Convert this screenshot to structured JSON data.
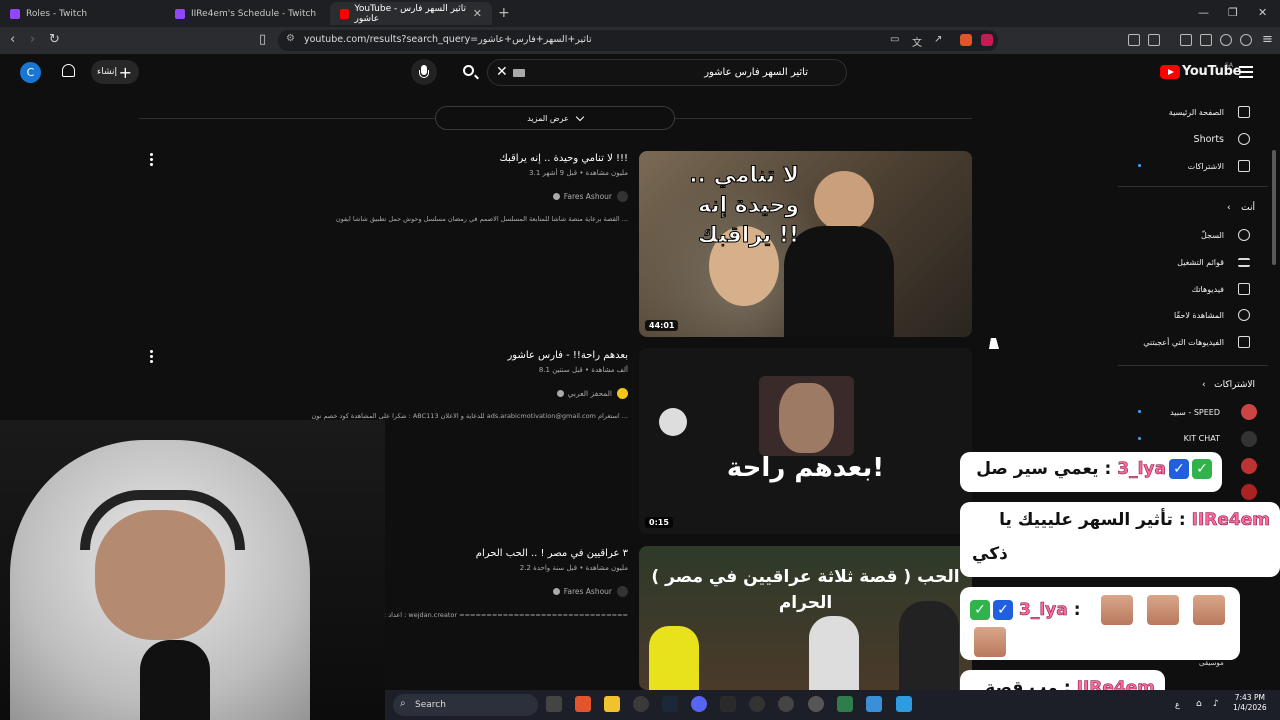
{
  "browser": {
    "tabs": [
      {
        "title": "Roles - Twitch",
        "active": false
      },
      {
        "title": "IIRe4em's Schedule - Twitch",
        "active": false
      },
      {
        "title": "YouTube - تاثير السهر فارس عاشور",
        "active": true
      }
    ],
    "url": "youtube.com/results?search_query=تاثير+السهر+فارس+عاشور",
    "new_tab": "+"
  },
  "youtube": {
    "logo": "YouTube",
    "region": "SA",
    "search_query": "تاثير السهر فارس عاشور",
    "create_label": "إنشاء",
    "avatar_letter": "C",
    "show_more": "عرض المزيد"
  },
  "sidebar": {
    "main": [
      {
        "label": "الصفحة الرئيسية",
        "icon": "home-icon"
      },
      {
        "label": "Shorts",
        "icon": "shorts-icon"
      },
      {
        "label": "الاشتراكات",
        "icon": "subscriptions-icon"
      }
    ],
    "you_header": "أنت",
    "you": [
      {
        "label": "السجلّ",
        "icon": "history-icon"
      },
      {
        "label": "قوائم التشغيل",
        "icon": "playlists-icon"
      },
      {
        "label": "فيديوهاتك",
        "icon": "your-videos-icon"
      },
      {
        "label": "المشاهدة لاحقًا",
        "icon": "watch-later-icon"
      },
      {
        "label": "الفيديوهات التي أعجبتني",
        "icon": "liked-icon"
      }
    ],
    "subs_header": "الاشتراكات",
    "subs": [
      {
        "label": "سبيد - SPEED"
      },
      {
        "label": "KIT CHAT"
      }
    ],
    "partial_label": "موسيقى"
  },
  "videos": [
    {
      "title": "لا تنامي وحيدة .. إنه يراقبك !!!",
      "meta": "3.1 مليون مشاهدة • قبل 9 أشهر",
      "channel": "Fares Ashour",
      "description": "القصة برعاية منصة شاشا للمتابعة المسلسل الاصمم في رمضان مسلسل وحوش حمل تطبيق شاشا ايفون ...",
      "duration": "44:01",
      "thumb_text": "لا تنامي .. وحيدة إنه يراقبك !!"
    },
    {
      "title": "بعدهم راحة!! - فارس عاشور",
      "meta": "8.1 ألف مشاهدة • قبل سنتين",
      "channel": "المحفز العربي",
      "description": "شكرا على المشاهدة كود خصم نون : ABC113 للدعاية و الاعلان ads.arabicmotivation@gmail.com استغرام ...",
      "duration": "0:15",
      "thumb_text": "بعدهم راحة!"
    },
    {
      "title": "٣ عراقيين في مصر ! .. الحب الحرام",
      "meta": "2.2 مليون مشاهدة • قبل سنة واحدة",
      "channel": "Fares Ashour",
      "description": "اعداد : وجدان الشعري انستغرام : wejdan.creator ===============================",
      "duration": "",
      "thumb_text": "( قصة ثلاثة عراقيين في مصر ) الحب الحرام"
    }
  ],
  "chat": [
    {
      "user": "3_lya",
      "message": "يعمي سير صل"
    },
    {
      "user": "IIRe4em",
      "message": "تأثير السهر عليييك يا",
      "message2": "ذكي"
    },
    {
      "user": "3_lya",
      "message": ""
    },
    {
      "user": "IIRe4em",
      "message": "مب قصة"
    }
  ],
  "taskbar": {
    "search": "Search",
    "time": "7:43 PM",
    "date": "1/4/2026",
    "lang": "ع"
  },
  "colors": {
    "yt_red": "#ff0000",
    "bg": "#0f0f0f",
    "chat_user": "#ff6a9c"
  }
}
